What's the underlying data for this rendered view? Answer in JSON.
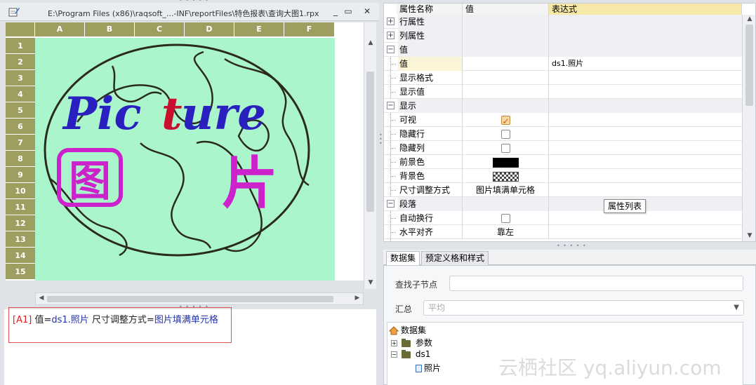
{
  "document": {
    "title": "E:\\Program Files (x86)\\raqsoft_...-INF\\reportFiles\\特色报表\\查询大图1.rpx",
    "window_buttons": [
      "_",
      "▭",
      "✕"
    ],
    "columns": [
      "A",
      "B",
      "C",
      "D",
      "E",
      "F"
    ],
    "rows": [
      "1",
      "2",
      "3",
      "4",
      "5",
      "6",
      "7",
      "8",
      "9",
      "10",
      "11",
      "12",
      "13",
      "14",
      "15"
    ],
    "picture": {
      "text": "Picture",
      "text_colors": [
        "#2a1fbf",
        "#c8102e"
      ],
      "char1": "图",
      "char2": "片",
      "char_color": "#cc22cc",
      "background": "#aaf5cc"
    }
  },
  "status": {
    "cell_ref": "[A1]",
    "value_key": "值=",
    "value": "ds1.照片",
    "mode_key": " 尺寸调整方式=",
    "mode": "图片填满单元格"
  },
  "properties": {
    "headers": {
      "name": "属性名称",
      "value": "值",
      "expression": "表达式"
    },
    "rows": [
      {
        "name": "行属性",
        "type": "group",
        "toggle": "+",
        "value": "",
        "expression": ""
      },
      {
        "name": "列属性",
        "type": "group",
        "toggle": "+",
        "value": "",
        "expression": ""
      },
      {
        "name": "值",
        "type": "group",
        "toggle": "−",
        "value": "",
        "expression": ""
      },
      {
        "name": "值",
        "type": "item",
        "value": "",
        "expression": "ds1.照片"
      },
      {
        "name": "显示格式",
        "type": "item",
        "value": "",
        "expression": ""
      },
      {
        "name": "显示值",
        "type": "item",
        "value": "",
        "expression": ""
      },
      {
        "name": "显示",
        "type": "group",
        "toggle": "−",
        "value": "",
        "expression": ""
      },
      {
        "name": "可视",
        "type": "check",
        "checked": true,
        "expression": ""
      },
      {
        "name": "隐藏行",
        "type": "check",
        "checked": false,
        "expression": ""
      },
      {
        "name": "隐藏列",
        "type": "check",
        "checked": false,
        "expression": ""
      },
      {
        "name": "前景色",
        "type": "color",
        "swatch": "black",
        "expression": ""
      },
      {
        "name": "背景色",
        "type": "color",
        "swatch": "checker",
        "expression": ""
      },
      {
        "name": "尺寸调整方式",
        "type": "item",
        "value": "图片填满单元格",
        "expression": ""
      },
      {
        "name": "段落",
        "type": "group",
        "toggle": "−",
        "value": "",
        "expression": ""
      },
      {
        "name": "自动换行",
        "type": "check",
        "checked": false,
        "expression": ""
      },
      {
        "name": "水平对齐",
        "type": "item",
        "value": "靠左",
        "expression": ""
      },
      {
        "name": "",
        "type": "item",
        "value": "",
        "expression": ""
      }
    ],
    "tooltip": "属性列表"
  },
  "dataset_panel": {
    "tabs": [
      "数据集",
      "预定义格和样式"
    ],
    "find_label": "查找子节点",
    "find_value": "",
    "summary_label": "汇总",
    "summary_value": "平均",
    "tree": {
      "root": "数据集",
      "children": [
        {
          "label": "参数",
          "toggle": "+"
        },
        {
          "label": "ds1",
          "toggle": "−",
          "children": [
            "照片"
          ]
        }
      ]
    }
  },
  "watermark": "云栖社区 yq.aliyun.com"
}
